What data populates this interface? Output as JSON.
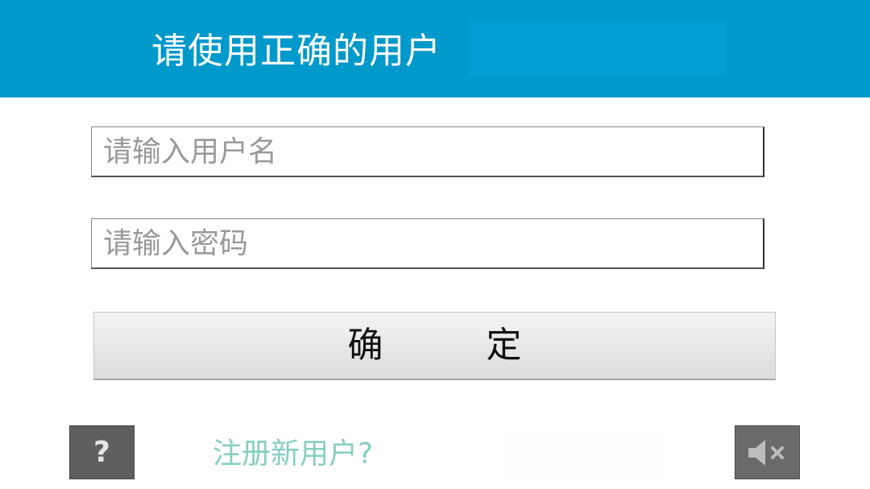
{
  "header": {
    "title": "请使用正确的用户"
  },
  "login": {
    "username_placeholder": "请输入用户名",
    "username_value": "",
    "password_placeholder": "请输入密码",
    "password_value": "",
    "confirm_label": "确定"
  },
  "footer": {
    "help_label": "?",
    "register_label": "注册新用户?",
    "mute_icon": "speaker-muted-icon"
  },
  "colors": {
    "header_bg": "#0099cc",
    "link": "#86cfc2",
    "icon_button_bg": "#5f5f5f"
  }
}
